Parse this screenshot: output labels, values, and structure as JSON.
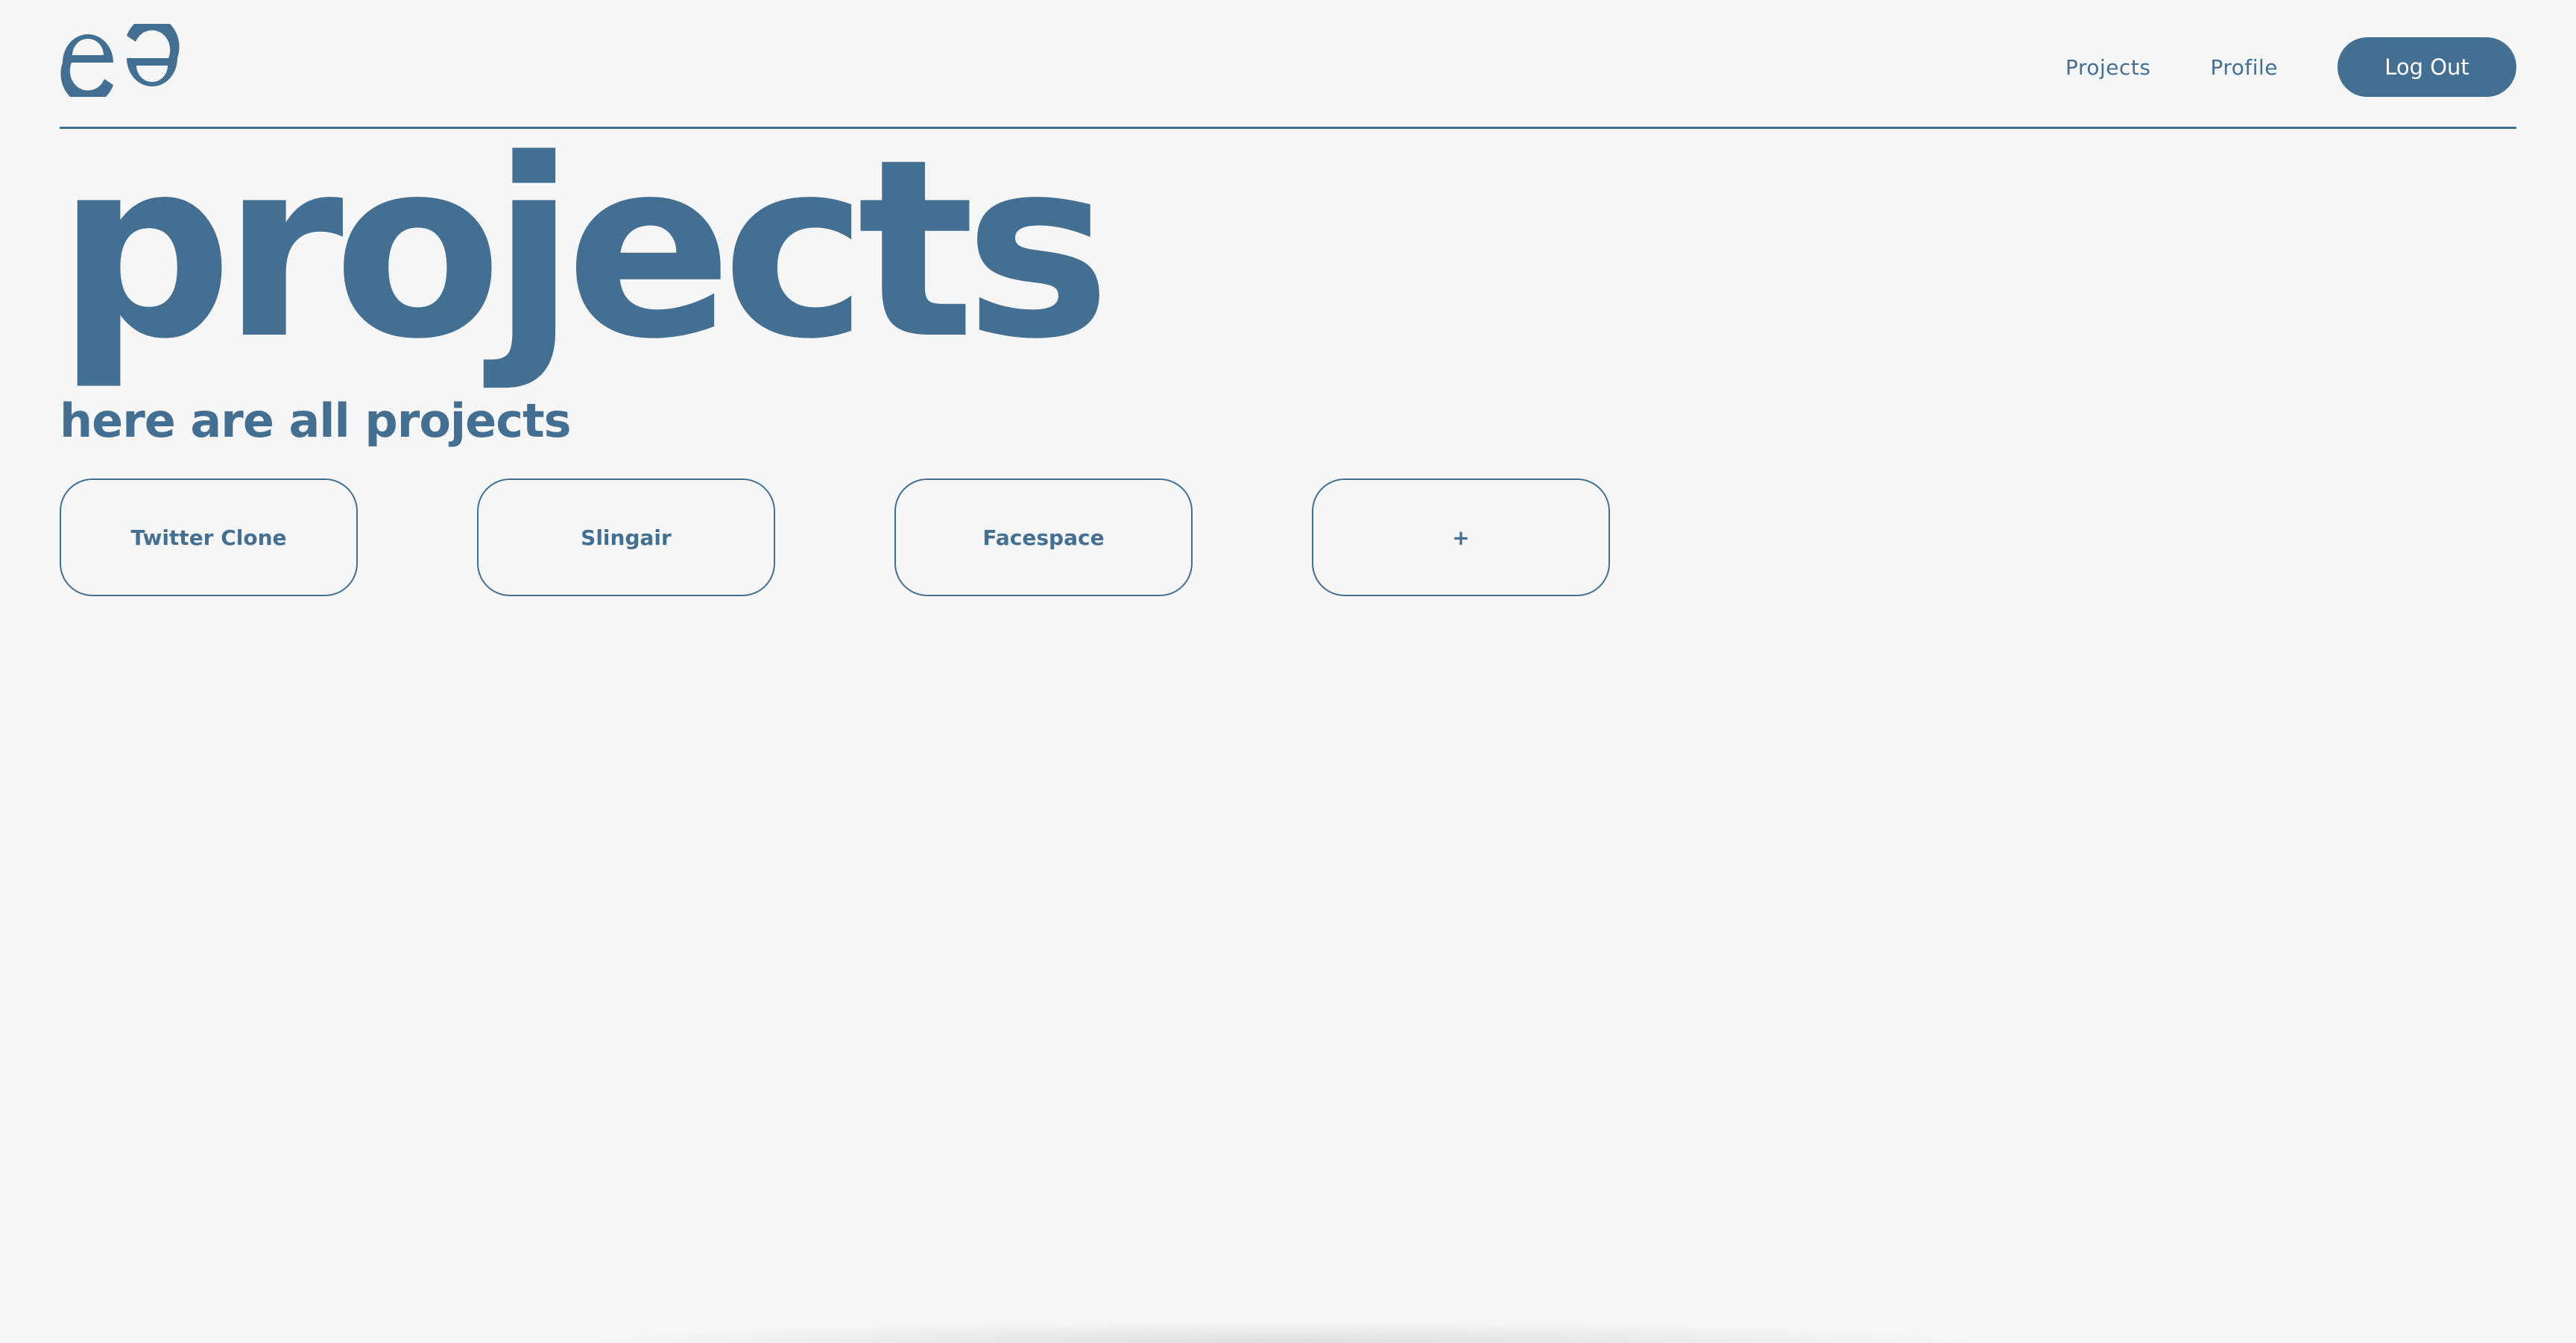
{
  "header": {
    "nav": {
      "projects_label": "Projects",
      "profile_label": "Profile",
      "logout_label": "Log Out"
    }
  },
  "main": {
    "title": "projects",
    "subtitle": "here are all projects",
    "projects": [
      {
        "label": "Twitter Clone"
      },
      {
        "label": "Slingair"
      },
      {
        "label": "Facespace"
      },
      {
        "label": "+"
      }
    ]
  },
  "colors": {
    "background": "#f6f6f6",
    "accent": "#436f92",
    "button_text": "#ffffff"
  },
  "icons": {
    "logo": "ee-logo-icon"
  }
}
